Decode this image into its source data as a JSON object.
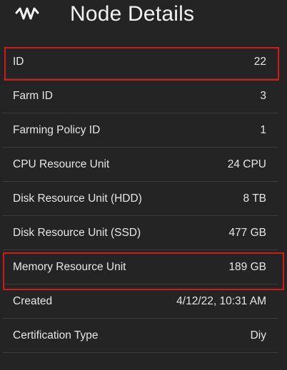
{
  "header": {
    "logo_icon": "threefold-logo-icon",
    "title": "Node Details"
  },
  "details": [
    {
      "label": "ID",
      "value": "22",
      "highlighted": true
    },
    {
      "label": "Farm ID",
      "value": "3",
      "highlighted": false
    },
    {
      "label": "Farming Policy ID",
      "value": "1",
      "highlighted": false
    },
    {
      "label": "CPU Resource Unit",
      "value": "24 CPU",
      "highlighted": false
    },
    {
      "label": "Disk Resource Unit (HDD)",
      "value": "8 TB",
      "highlighted": false
    },
    {
      "label": "Disk Resource Unit (SSD)",
      "value": "477 GB",
      "highlighted": false
    },
    {
      "label": "Memory Resource Unit",
      "value": "189 GB",
      "highlighted": true
    },
    {
      "label": "Created",
      "value": "4/12/22, 10:31 AM",
      "highlighted": false
    },
    {
      "label": "Certification Type",
      "value": "Diy",
      "highlighted": false
    }
  ],
  "colors": {
    "background": "#242424",
    "text": "#e6e6e6",
    "divider": "#3b3b3b",
    "highlight_border": "#d11a1a"
  }
}
